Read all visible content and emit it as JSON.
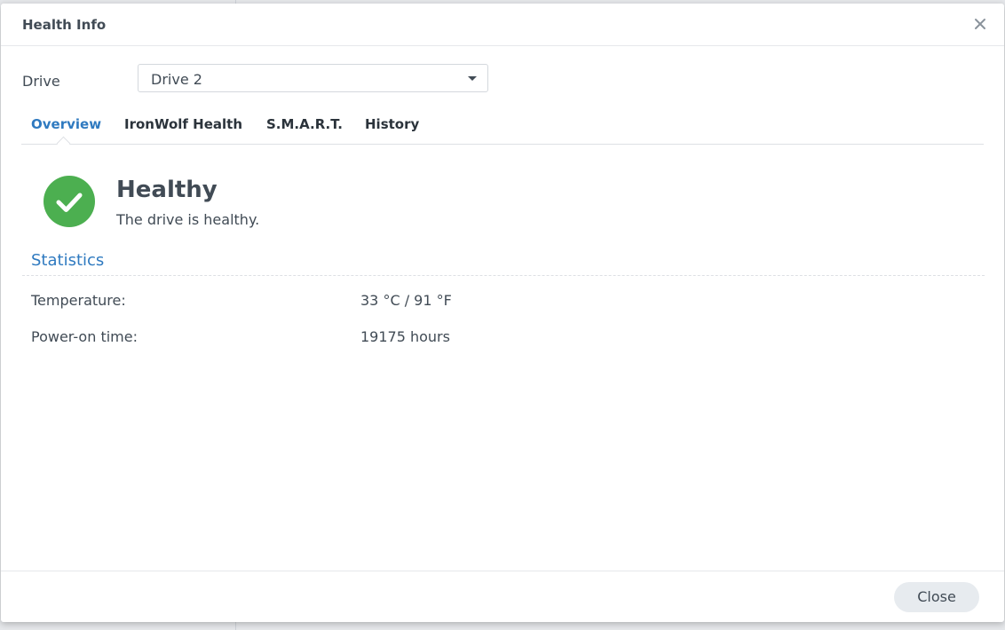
{
  "dialog": {
    "title": "Health Info",
    "close_icon": "close-icon"
  },
  "drive": {
    "label": "Drive",
    "selected": "Drive 2"
  },
  "tabs": [
    {
      "label": "Overview",
      "active": true
    },
    {
      "label": "IronWolf Health",
      "active": false
    },
    {
      "label": "S.M.A.R.T.",
      "active": false
    },
    {
      "label": "History",
      "active": false
    }
  ],
  "status": {
    "icon": "check-circle-icon",
    "title": "Healthy",
    "description": "The drive is healthy.",
    "color": "#4caf50"
  },
  "statistics": {
    "title": "Statistics",
    "rows": [
      {
        "label": "Temperature:",
        "value": "33 °C / 91 °F"
      },
      {
        "label": "Power-on time:",
        "value": "19175 hours"
      }
    ]
  },
  "footer": {
    "close_label": "Close"
  },
  "colors": {
    "accent": "#2f7ac0",
    "text": "#414b55",
    "success": "#4caf50"
  }
}
